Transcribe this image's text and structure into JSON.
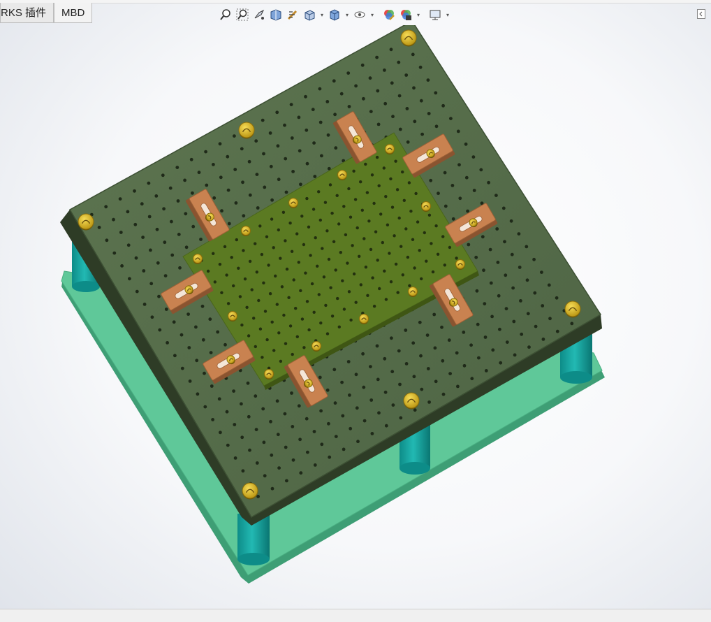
{
  "tabs": [
    {
      "label": "RKS 插件",
      "active": false
    },
    {
      "label": "MBD",
      "active": true
    }
  ],
  "toolbar": {
    "items": [
      {
        "icon": "zoom-to-fit-icon"
      },
      {
        "icon": "zoom-to-area-icon"
      },
      {
        "icon": "previous-view-icon"
      },
      {
        "icon": "section-view-icon"
      },
      {
        "icon": "dynamic-annotation-views-icon"
      },
      {
        "icon": "view-orientation-icon",
        "dropdown": true
      },
      {
        "icon": "display-style-icon",
        "dropdown": true
      },
      {
        "icon": "hide-show-items-icon",
        "dropdown": true
      },
      {
        "icon": "edit-appearance-icon"
      },
      {
        "icon": "apply-scene-icon",
        "dropdown": true
      },
      {
        "icon": "view-settings-icon",
        "dropdown": true
      }
    ]
  },
  "model": {
    "colors": {
      "base_plate": "#5fc899",
      "pillars": "#17a7a2",
      "main_plate": "#556b48",
      "center_board": "#5b7a22",
      "clamps": "#c98250",
      "screws": "#e3c12f"
    }
  }
}
